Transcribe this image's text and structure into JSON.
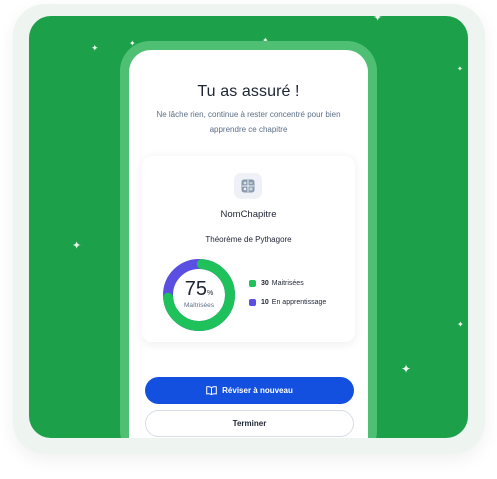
{
  "modal": {
    "title": "Tu as assuré !",
    "subtitle": "Ne lâche rien, continue à rester concentré pour bien apprendre ce chapitre"
  },
  "chapter": {
    "name": "NomChapitre",
    "theorem": "Théorème de Pythagore",
    "icon": "calculator-icon"
  },
  "progress": {
    "value": "75",
    "unit": "%",
    "label": "Maîtrisées",
    "fraction": 0.75,
    "colors": {
      "mastered": "#1fc15a",
      "learning": "#5a4fe0"
    }
  },
  "legend": [
    {
      "count": "30",
      "label": "Maitrisées",
      "color": "#1fc15a"
    },
    {
      "count": "10",
      "label": "En apprentissage",
      "color": "#5a4fe0"
    }
  ],
  "actions": {
    "review_label": "Réviser à nouveau",
    "finish_label": "Terminer"
  },
  "theme": {
    "background_green": "#1ca14a",
    "primary_button": "#1450e0"
  }
}
